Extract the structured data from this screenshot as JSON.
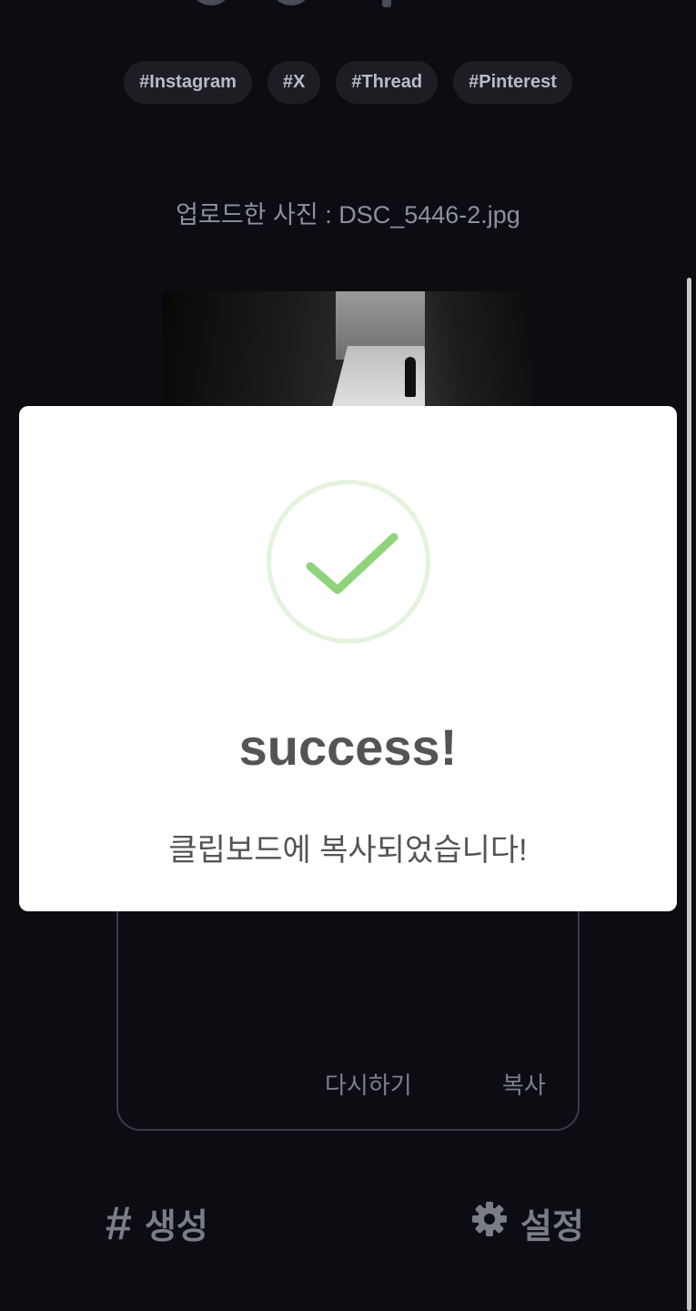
{
  "tags": [
    "#Instagram",
    "#X",
    "#Thread",
    "#Pinterest"
  ],
  "upload": {
    "label": "업로드한 사진 : DSC_5446-2.jpg"
  },
  "card": {
    "retry_label": "다시하기",
    "copy_label": "복사"
  },
  "nav": {
    "generate_label": "생성",
    "generate_icon": "hash-icon",
    "settings_label": "설정",
    "settings_icon": "gear-icon"
  },
  "dialog": {
    "title": "success!",
    "message": "클립보드에 복사되었습니다!",
    "icon": "checkmark-icon",
    "accent_color": "#8fd47a",
    "ring_color": "#e3f3dc"
  },
  "colors": {
    "background": "#0b0d12",
    "tag_bg": "#1c1e23"
  }
}
